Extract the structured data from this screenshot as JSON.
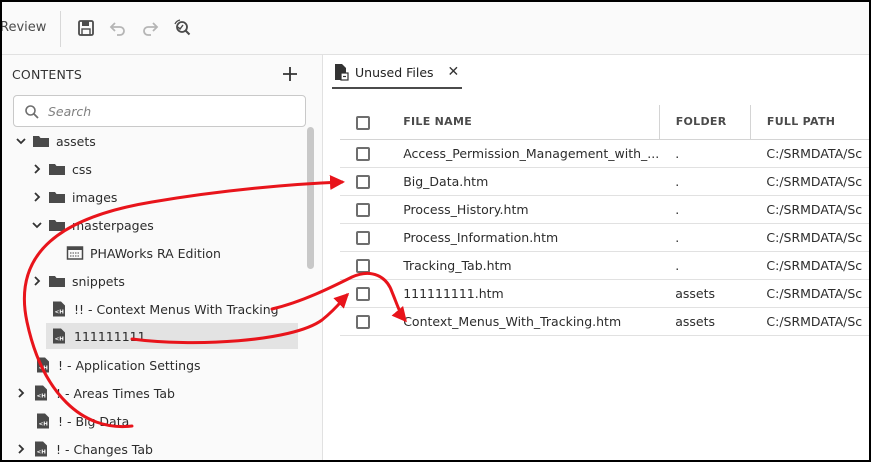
{
  "toolbar": {
    "review_label": "Review",
    "icons": [
      "save-icon",
      "undo-icon",
      "redo-icon",
      "find-replace-icon"
    ]
  },
  "sidebar": {
    "title": "CONTENTS",
    "search_placeholder": "Search",
    "tree": [
      {
        "label": "assets",
        "expanded": true
      },
      {
        "label": "css"
      },
      {
        "label": "images"
      },
      {
        "label": "masterpages",
        "expanded": true
      },
      {
        "label": "PHAWorks RA Edition"
      },
      {
        "label": "snippets"
      },
      {
        "label": "!! - Context Menus With Tracking"
      },
      {
        "label": "111111111",
        "selected": true
      },
      {
        "label": "! - Application Settings"
      },
      {
        "label": "! - Areas Times Tab"
      },
      {
        "label": "! - Big Data"
      },
      {
        "label": "! - Changes Tab"
      }
    ]
  },
  "main": {
    "tab_label": "Unused Files",
    "columns": [
      "FILE NAME",
      "FOLDER",
      "FULL PATH"
    ],
    "rows": [
      {
        "name": "Access_Permission_Management_with_...",
        "folder": ".",
        "path": "C:/SRMDATA/Sc"
      },
      {
        "name": "Big_Data.htm",
        "folder": ".",
        "path": "C:/SRMDATA/Sc"
      },
      {
        "name": "Process_History.htm",
        "folder": ".",
        "path": "C:/SRMDATA/Sc"
      },
      {
        "name": "Process_Information.htm",
        "folder": ".",
        "path": "C:/SRMDATA/Sc"
      },
      {
        "name": "Tracking_Tab.htm",
        "folder": ".",
        "path": "C:/SRMDATA/Sc"
      },
      {
        "name": "111111111.htm",
        "folder": "assets",
        "path": "C:/SRMDATA/Sc"
      },
      {
        "name": "Context_Menus_With_Tracking.htm",
        "folder": "assets",
        "path": "C:/SRMDATA/Sc"
      }
    ]
  },
  "colors": {
    "annotation_arrow": "#e8141b",
    "selection": "#e3e3e3",
    "accent": "#4b4b4b"
  }
}
